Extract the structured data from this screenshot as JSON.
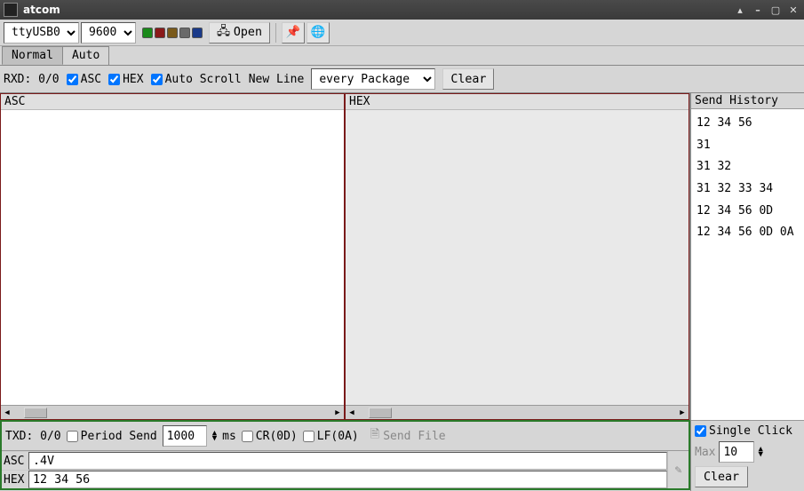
{
  "window": {
    "title": "atcom"
  },
  "toolbar": {
    "port": "ttyUSB0",
    "baud": "9600",
    "open_label": "Open"
  },
  "tabs": {
    "normal": "Normal",
    "auto": "Auto"
  },
  "rxbar": {
    "rxd_label": "RXD: 0/0",
    "asc_label": "ASC",
    "hex_label": "HEX",
    "autoscroll_label": "Auto Scroll",
    "newline_label": "New Line",
    "newline_value": "every Package",
    "clear_label": "Clear"
  },
  "cols": {
    "asc": "ASC",
    "hex": "HEX"
  },
  "history": {
    "title": "Send History",
    "items": [
      "12 34 56",
      "31",
      "31 32",
      "31 32 33 34",
      "12 34 56 0D",
      "12 34 56 0D 0A"
    ],
    "single_click_label": "Single Click",
    "max_label": "Max",
    "max_value": "10",
    "clear_label": "Clear"
  },
  "tx": {
    "txd_label": "TXD: 0/0",
    "period_label": "Period Send",
    "period_value": "1000",
    "ms_label": "ms",
    "cr_label": "CR(0D)",
    "lf_label": "LF(0A)",
    "sendfile_label": "Send File",
    "asc_value": ".4V",
    "hex_value": "12 34 56"
  }
}
